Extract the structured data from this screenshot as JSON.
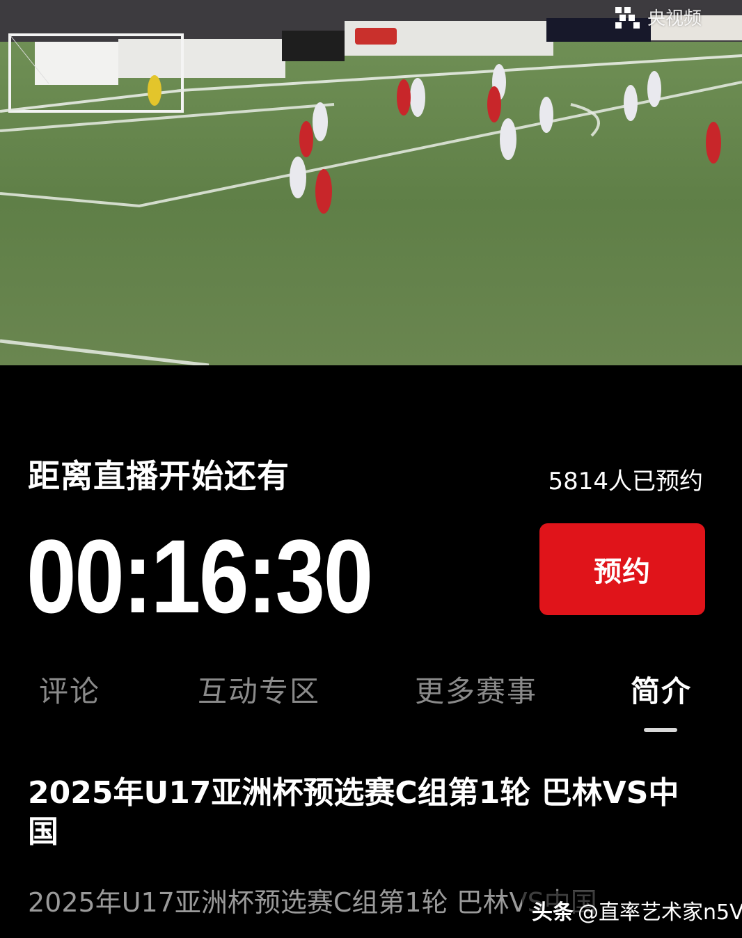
{
  "video": {
    "watermark_text": "央视频",
    "watermark_icon": "cctv-video-logo-icon"
  },
  "countdown": {
    "label": "距离直播开始还有",
    "time": "00:16:30"
  },
  "reservation": {
    "count_text": "5814人已预约",
    "button_label": "预约",
    "accent_color": "#e0141a"
  },
  "tabs": [
    {
      "label": "评论",
      "active": false
    },
    {
      "label": "互动专区",
      "active": false
    },
    {
      "label": "更多赛事",
      "active": false
    },
    {
      "label": "简介",
      "active": true
    }
  ],
  "description": {
    "title": "2025年U17亚洲杯预选赛C组第1轮 巴林VS中国",
    "subtitle": "2025年U17亚洲杯预选赛C组第1轮 巴林VS中国"
  },
  "source_tag": {
    "brand": "头条",
    "author": "@直率艺术家n5V"
  }
}
